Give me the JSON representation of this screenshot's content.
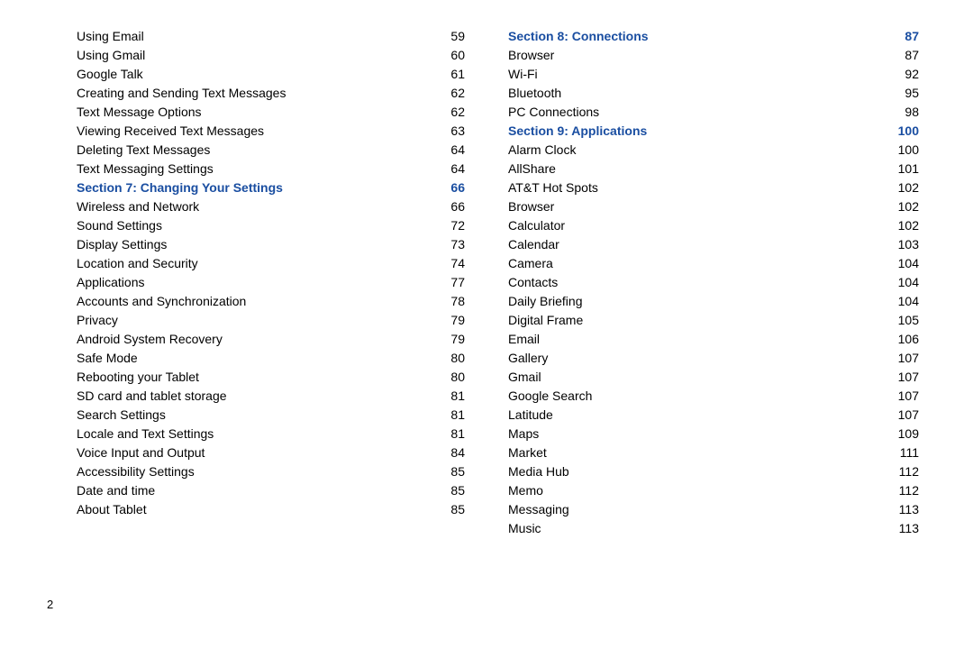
{
  "page_number": "2",
  "columns": [
    {
      "entries": [
        {
          "type": "item",
          "label": "Using Email",
          "page": "59"
        },
        {
          "type": "item",
          "label": "Using Gmail",
          "page": "60"
        },
        {
          "type": "item",
          "label": "Google Talk",
          "page": "61"
        },
        {
          "type": "item",
          "label": "Creating and Sending Text Messages",
          "page": "62"
        },
        {
          "type": "item",
          "label": "Text Message Options",
          "page": "62"
        },
        {
          "type": "item",
          "label": "Viewing Received Text Messages",
          "page": "63"
        },
        {
          "type": "item",
          "label": "Deleting Text Messages",
          "page": "64"
        },
        {
          "type": "item",
          "label": "Text Messaging Settings",
          "page": "64"
        },
        {
          "type": "section",
          "label": "Section 7:  Changing Your Settings",
          "page": "66"
        },
        {
          "type": "item",
          "label": "Wireless and Network",
          "page": "66"
        },
        {
          "type": "item",
          "label": "Sound Settings",
          "page": "72"
        },
        {
          "type": "item",
          "label": "Display Settings",
          "page": "73"
        },
        {
          "type": "item",
          "label": "Location and Security",
          "page": "74"
        },
        {
          "type": "item",
          "label": "Applications",
          "page": "77"
        },
        {
          "type": "item",
          "label": "Accounts and Synchronization",
          "page": "78"
        },
        {
          "type": "item",
          "label": "Privacy",
          "page": "79"
        },
        {
          "type": "item",
          "label": "Android System Recovery",
          "page": "79"
        },
        {
          "type": "item",
          "label": "Safe Mode",
          "page": "80"
        },
        {
          "type": "item",
          "label": "Rebooting your Tablet",
          "page": "80"
        },
        {
          "type": "item",
          "label": "SD card and tablet storage",
          "page": "81"
        },
        {
          "type": "item",
          "label": "Search Settings",
          "page": "81"
        },
        {
          "type": "item",
          "label": "Locale and Text Settings",
          "page": "81"
        },
        {
          "type": "item",
          "label": "Voice Input and Output",
          "page": "84"
        },
        {
          "type": "item",
          "label": "Accessibility Settings",
          "page": "85"
        },
        {
          "type": "item",
          "label": "Date and time",
          "page": "85"
        },
        {
          "type": "item",
          "label": "About Tablet",
          "page": "85"
        }
      ]
    },
    {
      "entries": [
        {
          "type": "section",
          "label": "Section 8:  Connections",
          "page": "87"
        },
        {
          "type": "item",
          "label": "Browser",
          "page": "87"
        },
        {
          "type": "item",
          "label": "Wi-Fi",
          "page": "92"
        },
        {
          "type": "item",
          "label": "Bluetooth",
          "page": "95"
        },
        {
          "type": "item",
          "label": "PC Connections",
          "page": "98"
        },
        {
          "type": "section",
          "label": "Section 9:  Applications",
          "page": "100"
        },
        {
          "type": "item",
          "label": "Alarm Clock",
          "page": "100"
        },
        {
          "type": "item",
          "label": "AllShare",
          "page": "101"
        },
        {
          "type": "item",
          "label": "AT&T Hot Spots",
          "page": "102"
        },
        {
          "type": "item",
          "label": "Browser",
          "page": "102"
        },
        {
          "type": "item",
          "label": "Calculator",
          "page": "102"
        },
        {
          "type": "item",
          "label": "Calendar",
          "page": "103"
        },
        {
          "type": "item",
          "label": "Camera",
          "page": "104"
        },
        {
          "type": "item",
          "label": "Contacts",
          "page": "104"
        },
        {
          "type": "item",
          "label": "Daily Briefing",
          "page": "104"
        },
        {
          "type": "item",
          "label": "Digital Frame",
          "page": "105"
        },
        {
          "type": "item",
          "label": "Email",
          "page": "106"
        },
        {
          "type": "item",
          "label": "Gallery",
          "page": "107"
        },
        {
          "type": "item",
          "label": "Gmail",
          "page": "107"
        },
        {
          "type": "item",
          "label": "Google Search",
          "page": "107"
        },
        {
          "type": "item",
          "label": "Latitude",
          "page": "107"
        },
        {
          "type": "item",
          "label": "Maps",
          "page": "109"
        },
        {
          "type": "item",
          "label": "Market",
          "page": "111"
        },
        {
          "type": "item",
          "label": "Media Hub",
          "page": "112"
        },
        {
          "type": "item",
          "label": "Memo",
          "page": "112"
        },
        {
          "type": "item",
          "label": "Messaging",
          "page": "113"
        },
        {
          "type": "item",
          "label": "Music",
          "page": "113"
        }
      ]
    }
  ]
}
